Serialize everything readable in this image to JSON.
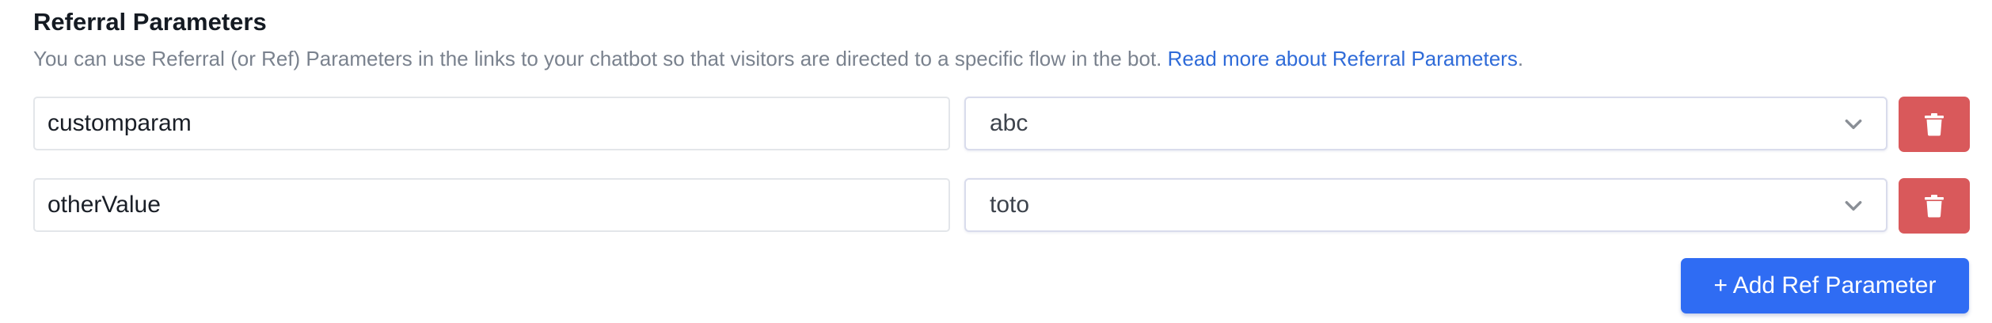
{
  "section": {
    "title": "Referral Parameters",
    "description": "You can use Referral (or Ref) Parameters in the links to your chatbot so that visitors are directed to a specific flow in the bot. ",
    "link_text": "Read more about Referral Parameters",
    "description_end": "."
  },
  "params": [
    {
      "key": "customparam",
      "value": "abc"
    },
    {
      "key": "otherValue",
      "value": "toto"
    }
  ],
  "icons": {
    "dropdown": "chevron-down-icon",
    "delete": "trash-icon"
  },
  "colors": {
    "link": "#2f6bd8",
    "delete_button": "#d9595b",
    "primary_button": "#2f6cf3"
  },
  "actions": {
    "add_label": "+ Add Ref Parameter"
  }
}
